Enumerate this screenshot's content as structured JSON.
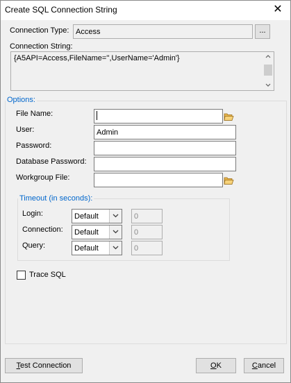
{
  "window": {
    "title": "Create SQL Connection String",
    "close_glyph": "✕"
  },
  "connection_type": {
    "label": "Connection Type:",
    "value": "Access",
    "browse_label": "..."
  },
  "connection_string": {
    "label": "Connection String:",
    "value": "{A5API=Access,FileName='',UserName='Admin'}"
  },
  "options": {
    "legend": "Options:",
    "file_name": {
      "label": "File Name:",
      "value": ""
    },
    "user": {
      "label": "User:",
      "value": "Admin"
    },
    "password": {
      "label": "Password:",
      "value": ""
    },
    "database_password": {
      "label": "Database Password:",
      "value": ""
    },
    "workgroup_file": {
      "label": "Workgroup File:",
      "value": ""
    }
  },
  "timeout": {
    "legend": "Timeout (in seconds):",
    "login": {
      "label": "Login:",
      "mode": "Default",
      "value": "0"
    },
    "connection": {
      "label": "Connection:",
      "mode": "Default",
      "value": "0"
    },
    "query": {
      "label": "Query:",
      "mode": "Default",
      "value": "0"
    }
  },
  "trace_sql": {
    "label": "Trace SQL",
    "checked": false
  },
  "buttons": {
    "test_connection": {
      "first": "T",
      "rest": "est Connection"
    },
    "ok": {
      "first": "O",
      "rest": "K"
    },
    "cancel": {
      "first": "C",
      "rest": "ancel"
    }
  },
  "icons": {
    "folder": "folder-open-icon",
    "dropdown": "chevron-down-icon",
    "close": "close-icon"
  }
}
